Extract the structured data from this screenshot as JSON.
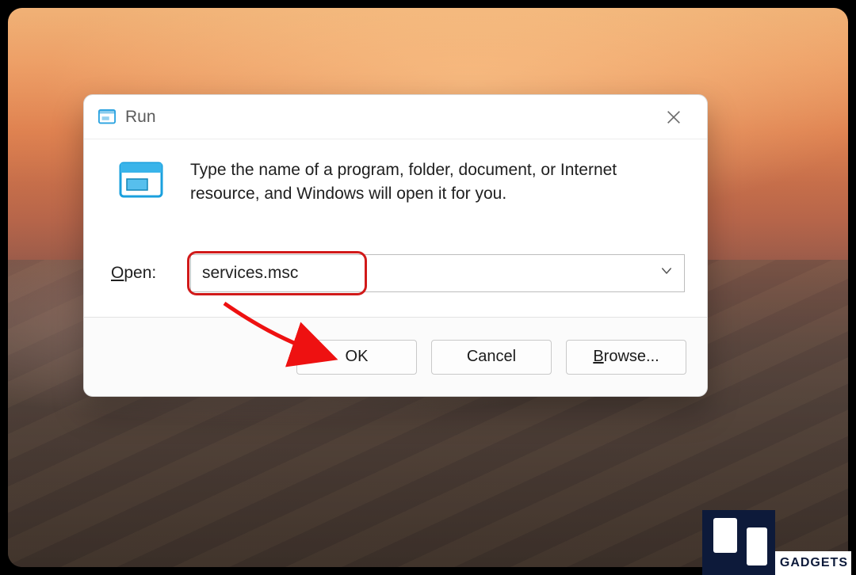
{
  "dialog": {
    "title": "Run",
    "instruction": "Type the name of a program, folder, document, or Internet resource, and Windows will open it for you.",
    "open_label_prefix": "O",
    "open_label_rest": "pen:",
    "input_value": "services.msc",
    "buttons": {
      "ok": "OK",
      "cancel": "Cancel",
      "browse_prefix": "B",
      "browse_rest": "rowse..."
    }
  },
  "watermark": "GADGETS"
}
